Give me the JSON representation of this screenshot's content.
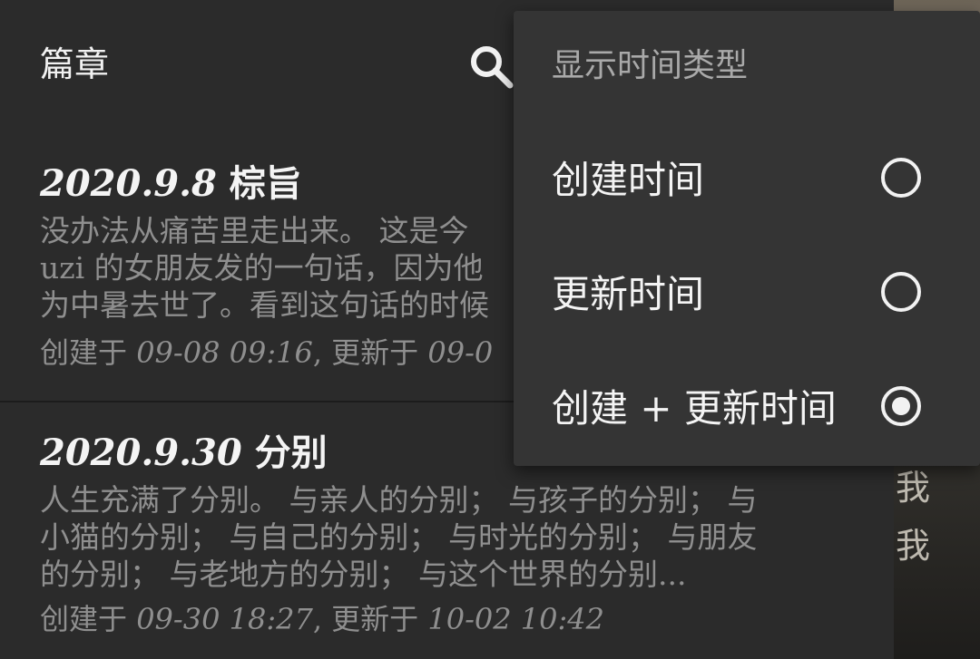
{
  "toolbar": {
    "title": "篇章",
    "search_icon": "search-icon"
  },
  "articles": [
    {
      "date": "2020.9.8",
      "title": "棕旨",
      "summary_lines": [
        "没办法从痛苦里走出来。  这是今",
        "uzi 的女朋友发的一句话，因为他",
        "为中暑去世了。看到这句话的时候"
      ],
      "meta_created_label": "创建于 ",
      "meta_created_value": "09-08 09:16",
      "meta_updated_label": ", 更新于 ",
      "meta_updated_value": "09-0"
    },
    {
      "date": "2020.9.30",
      "title": "分别",
      "summary_lines": [
        "人生充满了分别。 与亲人的分别； 与孩子的分别； 与",
        "小猫的分别； 与自己的分别； 与时光的分别； 与朋友",
        "的分别； 与老地方的分别； 与这个世界的分别..."
      ],
      "meta_created_label": "创建于 ",
      "meta_created_value": "09-30 18:27",
      "meta_updated_label": ", 更新于 ",
      "meta_updated_value": "10-02 10:42"
    }
  ],
  "background": {
    "chars": [
      "我",
      "我"
    ]
  },
  "menu": {
    "header": "显示时间类型",
    "options": [
      {
        "label": "创建时间",
        "selected": false
      },
      {
        "label": "更新时间",
        "selected": false
      },
      {
        "label": "创建 + 更新时间",
        "selected": true
      }
    ]
  },
  "colors": {
    "background": "#2b2b2b",
    "menu_background": "#343434",
    "primary_text": "#f4f4f4",
    "secondary_text": "#8f8f8f"
  }
}
